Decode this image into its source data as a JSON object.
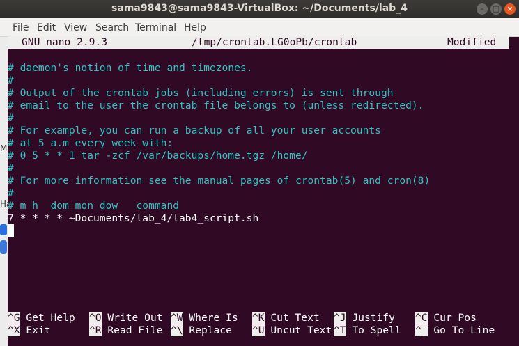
{
  "window": {
    "title": "sama9843@sama9843-VirtualBox: ~/Documents/lab_4",
    "controls": {
      "minimize": "–",
      "maximize": "□",
      "close": "×"
    }
  },
  "menubar": [
    "File",
    "Edit",
    "View",
    "Search",
    "Terminal",
    "Help"
  ],
  "nano_header": {
    "version": "GNU nano 2.9.3",
    "file": "/tmp/crontab.LG0oPb/crontab",
    "status": "Modified"
  },
  "editor_lines": [
    "# daemon's notion of time and timezones.",
    "#",
    "# Output of the crontab jobs (including errors) is sent through",
    "# email to the user the crontab file belongs to (unless redirected).",
    "#",
    "# For example, you can run a backup of all your user accounts",
    "# at 5 a.m every week with:",
    "# 0 5 * * 1 tar -zcf /var/backups/home.tgz /home/",
    "#",
    "# For more information see the manual pages of crontab(5) and cron(8)",
    "#",
    "# m h  dom mon dow   command",
    "7 * * * * ~Documents/lab_4/lab4_script.sh"
  ],
  "shortcuts": {
    "row1": [
      {
        "key": "^G",
        "label": "Get Help"
      },
      {
        "key": "^O",
        "label": "Write Out"
      },
      {
        "key": "^W",
        "label": "Where Is"
      },
      {
        "key": "^K",
        "label": "Cut Text"
      },
      {
        "key": "^J",
        "label": "Justify"
      },
      {
        "key": "^C",
        "label": "Cur Pos"
      }
    ],
    "row2": [
      {
        "key": "^X",
        "label": "Exit"
      },
      {
        "key": "^R",
        "label": "Read File"
      },
      {
        "key": "^\\",
        "label": "Replace"
      },
      {
        "key": "^U",
        "label": "Uncut Text"
      },
      {
        "key": "^T",
        "label": "To Spell"
      },
      {
        "key": "^_",
        "label": "Go To Line"
      }
    ]
  },
  "background_fragments": [
    "M",
    "Ha"
  ],
  "colors": {
    "terminal_bg": "#300a24",
    "comment": "#2fc2c2",
    "header_bg": "#eeeeec"
  }
}
